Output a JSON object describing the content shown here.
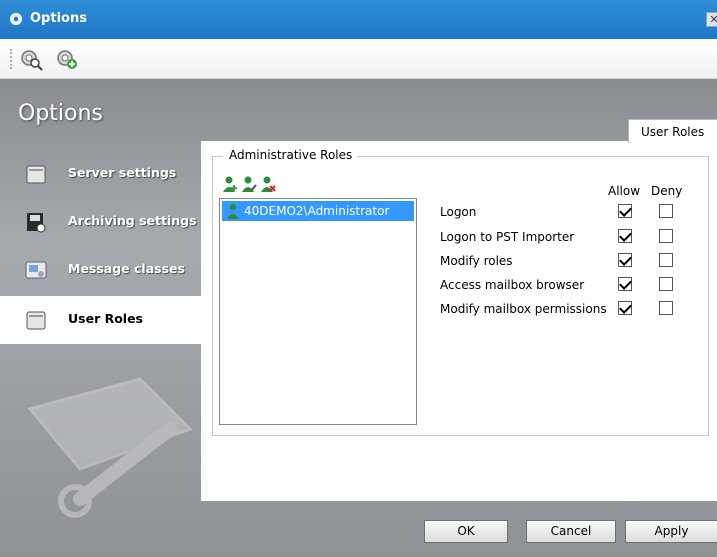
{
  "window": {
    "title": "Options",
    "close_glyph": "✕"
  },
  "toolbar": {
    "buttons": [
      {
        "icon": "gear-search-icon"
      },
      {
        "icon": "gear-add-icon"
      }
    ]
  },
  "sidebar": {
    "heading": "Options",
    "items": [
      {
        "label": "Server settings",
        "icon": "folder-icon",
        "active": false
      },
      {
        "label": "Archiving settings",
        "icon": "floppy-disk-icon",
        "active": false
      },
      {
        "label": "Message classes",
        "icon": "message-icon",
        "active": false
      },
      {
        "label": "User Roles",
        "icon": "folder-icon",
        "active": true
      }
    ]
  },
  "tab": {
    "label": "User Roles"
  },
  "group": {
    "legend": "Administrative Roles",
    "role_buttons": [
      {
        "icon": "add-user-icon"
      },
      {
        "icon": "edit-user-icon"
      },
      {
        "icon": "remove-user-icon"
      }
    ],
    "roles": [
      {
        "name": "40DEMO2\\Administrator",
        "selected": true
      }
    ]
  },
  "permissions": {
    "columns": {
      "allow": "Allow",
      "deny": "Deny"
    },
    "rows": [
      {
        "label": "Logon",
        "allow": true,
        "deny": false
      },
      {
        "label": "Logon to PST Importer",
        "allow": true,
        "deny": false
      },
      {
        "label": "Modify roles",
        "allow": true,
        "deny": false
      },
      {
        "label": "Access mailbox browser",
        "allow": true,
        "deny": false
      },
      {
        "label": "Modify mailbox permissions",
        "allow": true,
        "deny": false
      }
    ]
  },
  "footer": {
    "ok": "OK",
    "cancel": "Cancel",
    "apply": "Apply"
  }
}
